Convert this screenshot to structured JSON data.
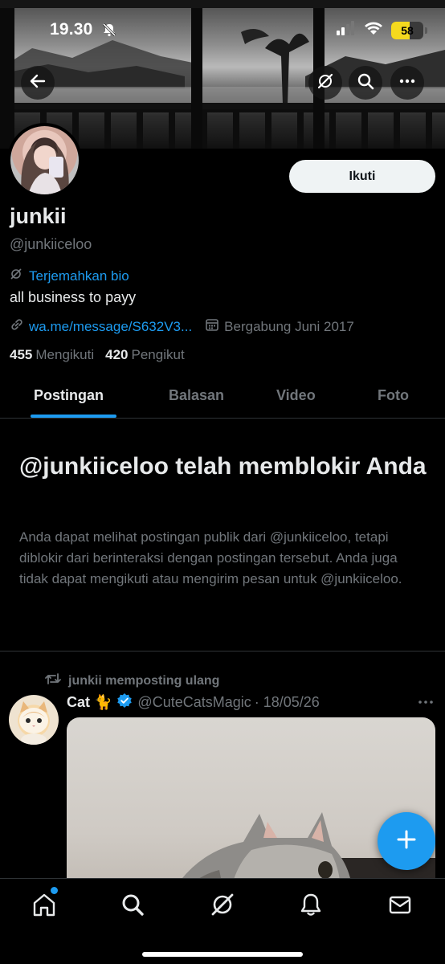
{
  "status_bar": {
    "time": "19.30",
    "battery": "58",
    "battery_level": 0.58
  },
  "profile": {
    "name": "junkii",
    "handle": "@junkiiceloo",
    "follow_label": "Ikuti",
    "translate_bio": "Terjemahkan bio",
    "bio": "all business to payy",
    "link": "wa.me/message/S632V3...",
    "joined": "Bergabung Juni 2017",
    "following_count": "455",
    "following_label": "Mengikuti",
    "followers_count": "420",
    "followers_label": "Pengikut"
  },
  "tabs": [
    "Postingan",
    "Balasan",
    "Video",
    "Foto"
  ],
  "blocked": {
    "title": "@junkiiceloo telah memblokir Anda",
    "body": "Anda dapat melihat postingan publik dari @junkiiceloo, tetapi diblokir dari berinteraksi dengan postingan tersebut. Anda juga tidak dapat mengikuti atau mengirim pesan untuk @junkiiceloo."
  },
  "post": {
    "repost_label": "junkii memposting ulang",
    "author_name": "Cat 🐈",
    "author_handle": "@CuteCatsMagic",
    "date": "· 18/05/26"
  },
  "colors": {
    "accent": "#1d9bf0",
    "background": "#000000",
    "muted": "#71767b"
  },
  "icons": [
    "back-arrow-icon",
    "grok-icon",
    "search-icon",
    "more-icon",
    "repost-icon",
    "verified-icon",
    "plus-icon",
    "home-icon",
    "bell-icon",
    "mail-icon",
    "link-icon",
    "calendar-icon"
  ]
}
